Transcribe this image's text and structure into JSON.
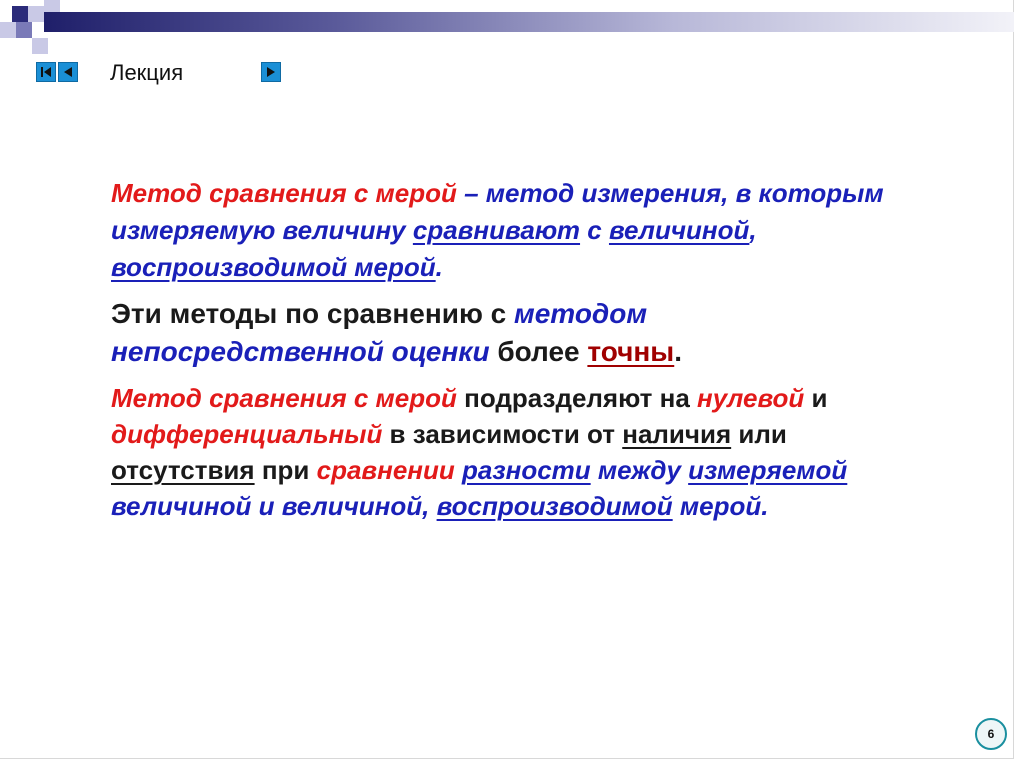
{
  "header": {
    "lecture_label": "Лекция"
  },
  "nav": {
    "icons": [
      "first-slide-icon",
      "prev-slide-icon",
      "next-slide-icon"
    ]
  },
  "colors": {
    "red": "#e21a1a",
    "blue": "#1a20b8",
    "dark": "#1a1a1a",
    "dark_red": "#a00000",
    "nav": "#1a8fd6"
  },
  "p1": {
    "s1": "Метод сравнения с мерой",
    "s2": " – метод измерения, в которым измеряемую величину ",
    "s3": "сравнивают",
    "s4": " с ",
    "s5": "величиной",
    "s6": ", ",
    "s7": "воспроизводимой мерой",
    "s8": "."
  },
  "p2": {
    "s1": "Эти методы по сравнению с ",
    "s2": "методом непосредственной оценки",
    "s3": " более ",
    "s4": "точны",
    "s5": "."
  },
  "p3": {
    "s1": "Метод сравнения с мерой",
    "s2": " подразделяют на ",
    "s3": "нулевой",
    "s4": " и ",
    "s5": "дифференциальный",
    "s6": " в зависимости от ",
    "s7": "наличия",
    "s8": " или ",
    "s9": "отсутствия",
    "s10": " при ",
    "s11": "сравнении",
    "s12": " ",
    "s13": "разности",
    "s14": " между ",
    "s15": "измеряемой",
    "s16": " величиной и величиной, ",
    "s17": "воспроизводимой",
    "s18": " мерой."
  },
  "footer": {
    "page_number": "6"
  }
}
